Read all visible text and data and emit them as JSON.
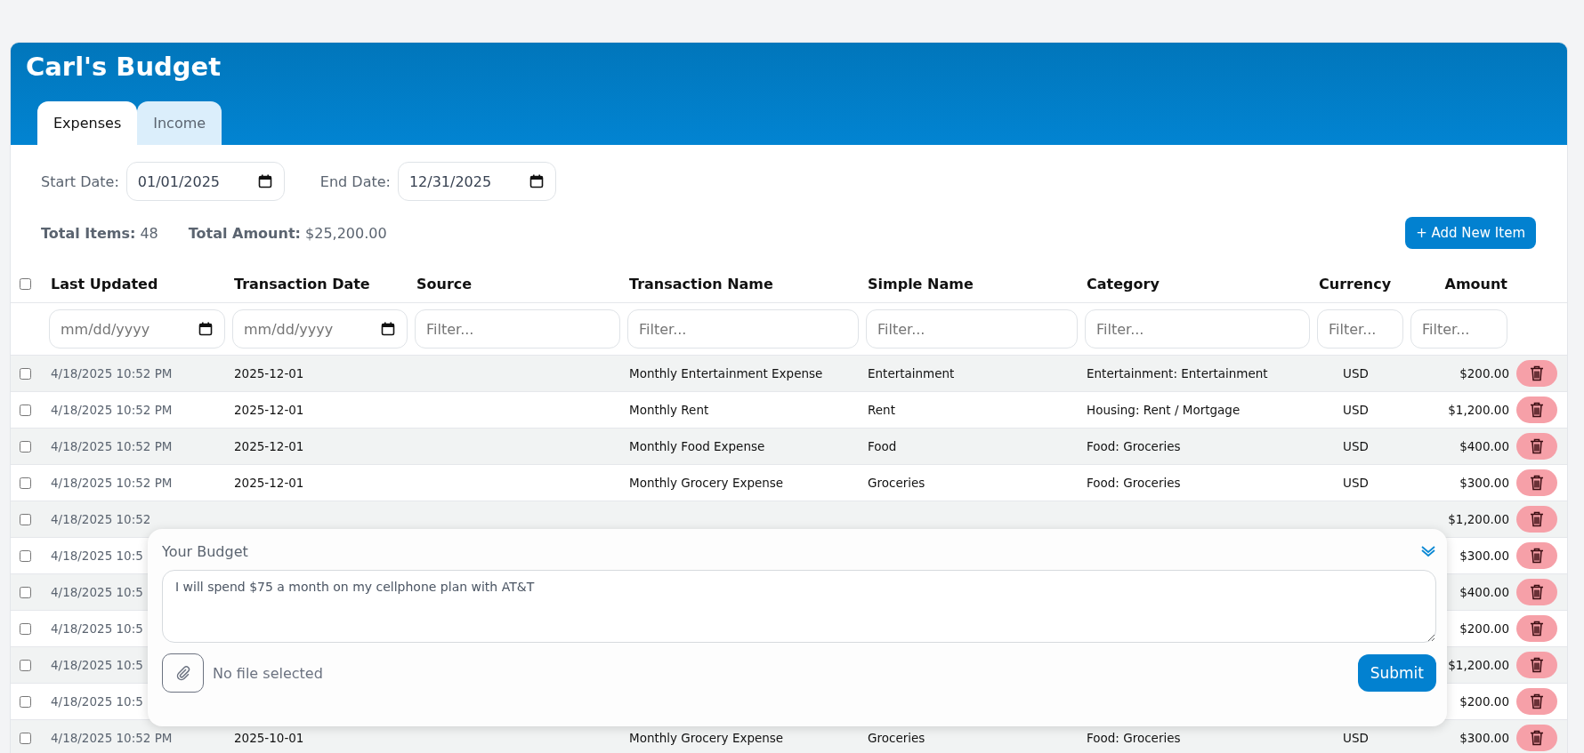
{
  "title": "Carl's Budget",
  "tabs": [
    {
      "label": "Expenses",
      "selected": true
    },
    {
      "label": "Income",
      "selected": false
    }
  ],
  "date_range": {
    "start_label": "Start Date:",
    "start_value": "01/01/2025",
    "end_label": "End Date:",
    "end_value": "12/31/2025"
  },
  "totals": {
    "items_label": "Total Items:",
    "items_value": "48",
    "amount_label": "Total Amount:",
    "amount_value": "$25,200.00"
  },
  "add_button": "+ Add New Item",
  "table": {
    "select_all_checked": false,
    "columns": [
      "Last Updated",
      "Transaction Date",
      "Source",
      "Transaction Name",
      "Simple Name",
      "Category",
      "Currency",
      "Amount"
    ],
    "filters": [
      {
        "kind": "date",
        "placeholder": "mm/dd/yyyy"
      },
      {
        "kind": "date",
        "placeholder": "mm/dd/yyyy"
      },
      {
        "kind": "text",
        "placeholder": "Filter..."
      },
      {
        "kind": "text",
        "placeholder": "Filter..."
      },
      {
        "kind": "text",
        "placeholder": "Filter..."
      },
      {
        "kind": "text",
        "placeholder": "Filter..."
      },
      {
        "kind": "text",
        "placeholder": "Filter..."
      },
      {
        "kind": "text",
        "placeholder": "Filter..."
      }
    ],
    "rows": [
      {
        "checked": false,
        "last_updated": "4/18/2025 10:52 PM",
        "transaction_date": "2025-12-01",
        "transaction_name": "Monthly Entertainment Expense",
        "simple_name": "Entertainment",
        "category": "Entertainment: Entertainment",
        "currency": "USD",
        "amount": "$200.00"
      },
      {
        "checked": false,
        "last_updated": "4/18/2025 10:52 PM",
        "transaction_date": "2025-12-01",
        "transaction_name": "Monthly Rent",
        "simple_name": "Rent",
        "category": "Housing: Rent / Mortgage",
        "currency": "USD",
        "amount": "$1,200.00"
      },
      {
        "checked": false,
        "last_updated": "4/18/2025 10:52 PM",
        "transaction_date": "2025-12-01",
        "transaction_name": "Monthly Food Expense",
        "simple_name": "Food",
        "category": "Food: Groceries",
        "currency": "USD",
        "amount": "$400.00"
      },
      {
        "checked": false,
        "last_updated": "4/18/2025 10:52 PM",
        "transaction_date": "2025-12-01",
        "transaction_name": "Monthly Grocery Expense",
        "simple_name": "Groceries",
        "category": "Food: Groceries",
        "currency": "USD",
        "amount": "$300.00"
      },
      {
        "checked": false,
        "last_updated": "4/18/2025 10:52",
        "amount": "$1,200.00"
      },
      {
        "checked": false,
        "last_updated": "4/18/2025 10:5",
        "amount": "$300.00"
      },
      {
        "checked": false,
        "last_updated": "4/18/2025 10:5",
        "amount": "$400.00"
      },
      {
        "checked": false,
        "last_updated": "4/18/2025 10:5",
        "amount": "$200.00"
      },
      {
        "checked": false,
        "last_updated": "4/18/2025 10:5",
        "amount": "$1,200.00"
      },
      {
        "checked": false,
        "last_updated": "4/18/2025 10:5",
        "amount": "$200.00"
      },
      {
        "checked": false,
        "last_updated": "4/18/2025 10:52 PM",
        "transaction_date": "2025-10-01",
        "transaction_name": "Monthly Grocery Expense",
        "simple_name": "Groceries",
        "category": "Food: Groceries",
        "currency": "USD",
        "amount": "$300.00"
      }
    ]
  },
  "budget_panel": {
    "title": "Your Budget",
    "text": "I will spend $75 a month on my cellphone plan with AT&T",
    "file_status": "No file selected",
    "submit": "Submit"
  }
}
